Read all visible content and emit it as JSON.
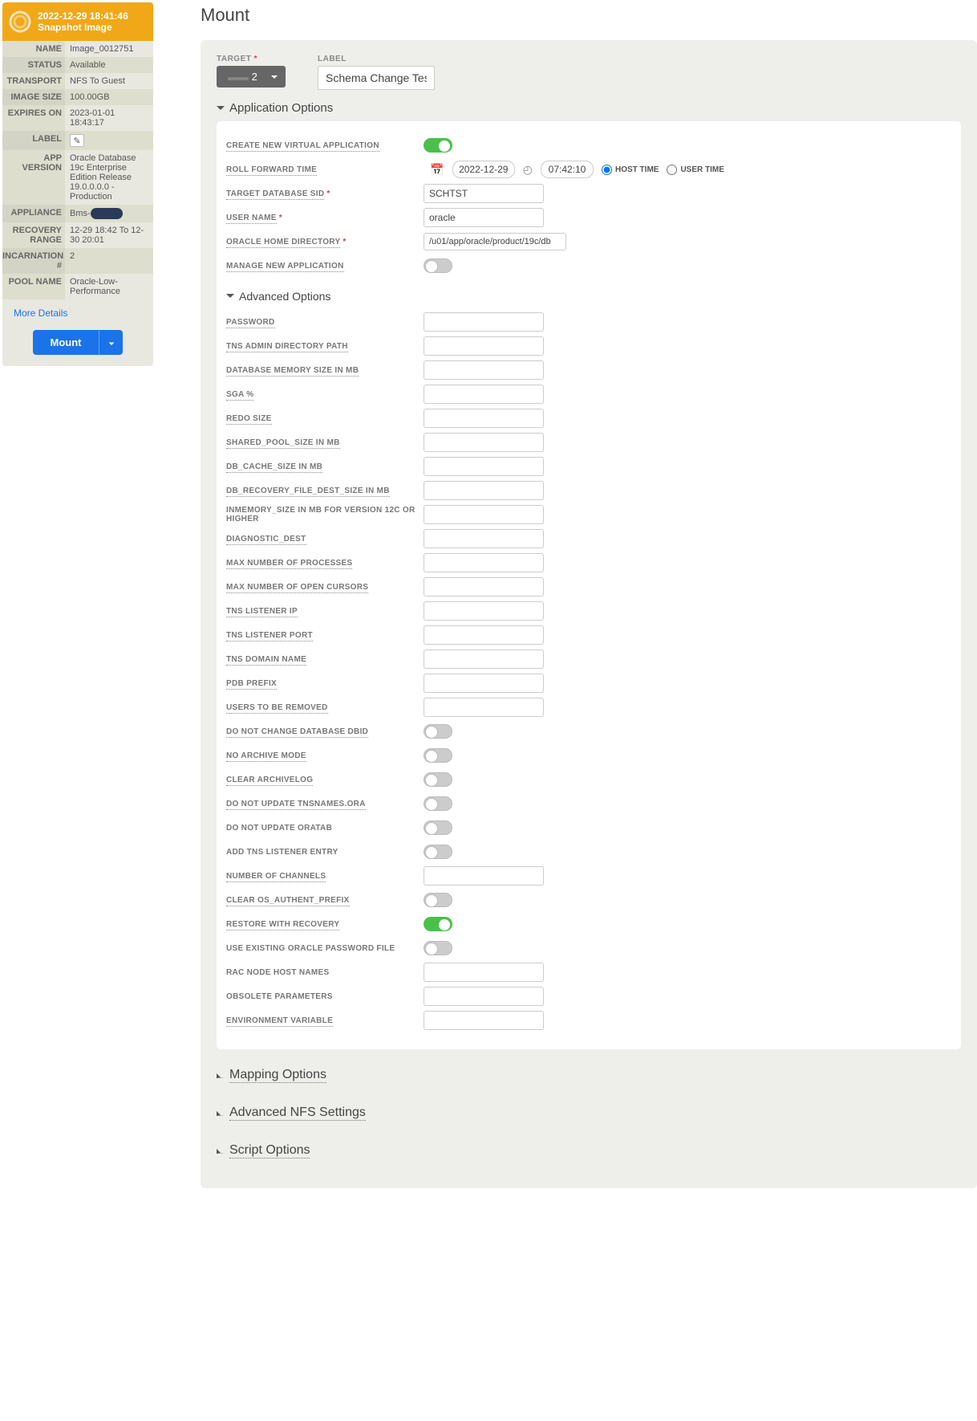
{
  "sidebar": {
    "timestamp": "2022-12-29  18:41:46",
    "subtitle": "Snapshot Image",
    "rows": [
      {
        "k": "NAME",
        "v": "Image_0012751"
      },
      {
        "k": "STATUS",
        "v": "Available"
      },
      {
        "k": "TRANSPORT",
        "v": "NFS To Guest"
      },
      {
        "k": "IMAGE SIZE",
        "v": "100.00GB"
      },
      {
        "k": "EXPIRES ON",
        "v": "2023-01-01 18:43:17"
      },
      {
        "k": "LABEL",
        "v": ""
      },
      {
        "k": "APP VERSION",
        "v": "Oracle Database 19c Enterprise Edition Release 19.0.0.0.0 - Production"
      },
      {
        "k": "APPLIANCE",
        "v": "Bms-"
      },
      {
        "k": "RECOVERY RANGE",
        "v": "12-29 18:42 To 12-30 20:01"
      },
      {
        "k": "INCARNATION #",
        "v": "2"
      },
      {
        "k": "POOL NAME",
        "v": "Oracle-Low-Performance"
      }
    ],
    "more": "More Details",
    "mount": "Mount"
  },
  "main": {
    "title": "Mount",
    "target_lbl": "TARGET",
    "label_lbl": "LABEL",
    "target_val": "2",
    "label_val": "Schema Change Test",
    "app_options": "Application Options",
    "adv_options": "Advanced Options",
    "fields": {
      "create_vapp": "CREATE NEW VIRTUAL APPLICATION",
      "rollfwd": "ROLL FORWARD TIME",
      "date": "2022-12-29",
      "time": "07:42:10",
      "hosttime": "HOST TIME",
      "usertime": "USER TIME",
      "sid": "TARGET DATABASE SID",
      "sid_v": "SCHTST",
      "user": "USER NAME",
      "user_v": "oracle",
      "ohome": "ORACLE HOME DIRECTORY",
      "ohome_v": "/u01/app/oracle/product/19c/db",
      "manage": "MANAGE NEW APPLICATION",
      "pwd": "PASSWORD",
      "tns_admin": "TNS ADMIN DIRECTORY PATH",
      "dbmem": "DATABASE MEMORY SIZE IN MB",
      "sga": "SGA %",
      "redo": "REDO SIZE",
      "shared_pool": "SHARED_POOL_SIZE IN MB",
      "dbcache": "DB_CACHE_SIZE IN MB",
      "dbrec": "DB_RECOVERY_FILE_DEST_SIZE IN MB",
      "inmem": "INMEMORY_SIZE IN MB FOR VERSION 12C OR HIGHER",
      "diag": "DIAGNOSTIC_DEST",
      "maxproc": "MAX NUMBER OF PROCESSES",
      "maxcur": "MAX NUMBER OF OPEN CURSORS",
      "tnsip": "TNS LISTENER IP",
      "tnsport": "TNS LISTENER PORT",
      "tnsdom": "TNS DOMAIN NAME",
      "pdb": "PDB PREFIX",
      "users_rm": "USERS TO BE REMOVED",
      "nodbid": "DO NOT CHANGE DATABASE DBID",
      "noarch": "NO ARCHIVE MODE",
      "cleararch": "CLEAR ARCHIVELOG",
      "notns": "DO NOT UPDATE TNSNAMES.ORA",
      "nooratab": "DO NOT UPDATE ORATAB",
      "addtns": "ADD TNS LISTENER ENTRY",
      "nchan": "NUMBER OF CHANNELS",
      "clearos": "CLEAR OS_AUTHENT_PREFIX",
      "restore": "RESTORE WITH RECOVERY",
      "usepwd": "USE EXISTING ORACLE PASSWORD FILE",
      "rac": "RAC NODE HOST NAMES",
      "obs": "OBSOLETE PARAMETERS",
      "env": "ENVIRONMENT VARIABLE"
    },
    "collapsed": [
      "Mapping Options",
      "Advanced NFS Settings",
      "Script Options"
    ]
  }
}
